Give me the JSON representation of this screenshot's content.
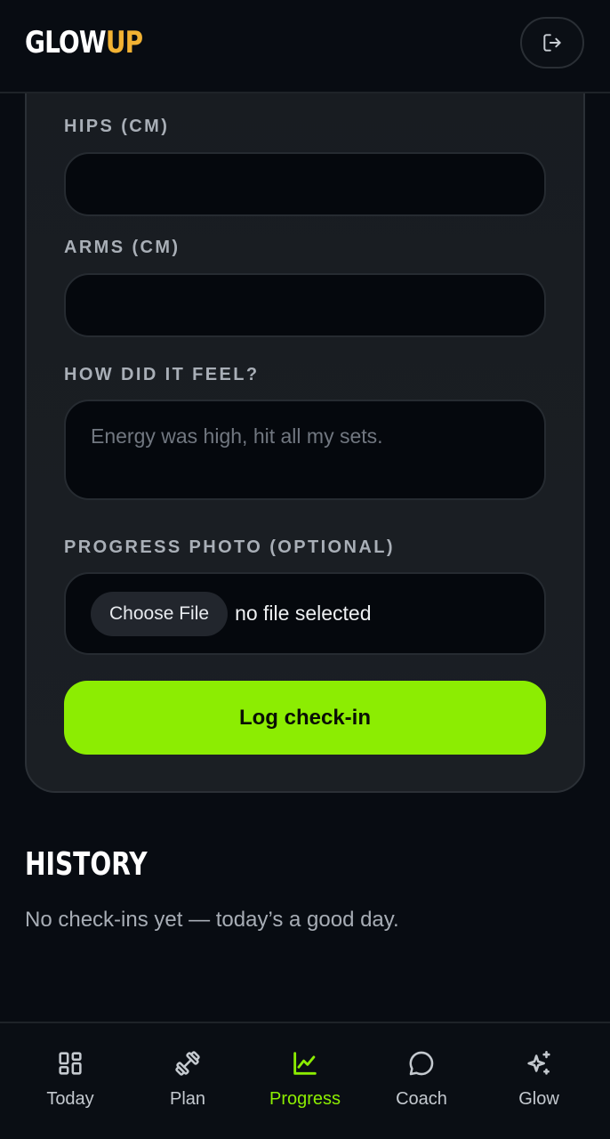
{
  "header": {
    "logo_part1": "GLOW",
    "logo_part2": "UP",
    "logout_icon": "logout-icon"
  },
  "form": {
    "hips_label": "HIPS (CM)",
    "hips_value": "",
    "arms_label": "ARMS (CM)",
    "arms_value": "",
    "feel_label": "HOW DID IT FEEL?",
    "feel_placeholder": "Energy was high, hit all my sets.",
    "photo_label": "PROGRESS PHOTO (OPTIONAL)",
    "choose_file_label": "Choose File",
    "no_file_text": "no file selected",
    "submit_label": "Log check-in"
  },
  "history": {
    "title": "HISTORY",
    "empty_text": "No check-ins yet — today’s a good day."
  },
  "nav": {
    "items": [
      {
        "label": "Today",
        "icon": "grid-icon",
        "active": false
      },
      {
        "label": "Plan",
        "icon": "dumbbell-icon",
        "active": false
      },
      {
        "label": "Progress",
        "icon": "chart-line-icon",
        "active": true
      },
      {
        "label": "Coach",
        "icon": "chat-bubble-icon",
        "active": false
      },
      {
        "label": "Glow",
        "icon": "sparkle-icon",
        "active": false
      }
    ]
  },
  "colors": {
    "accent": "#8ced02",
    "logo_accent": "#f2b233",
    "background": "#080c12",
    "card": "#1a1e23"
  }
}
